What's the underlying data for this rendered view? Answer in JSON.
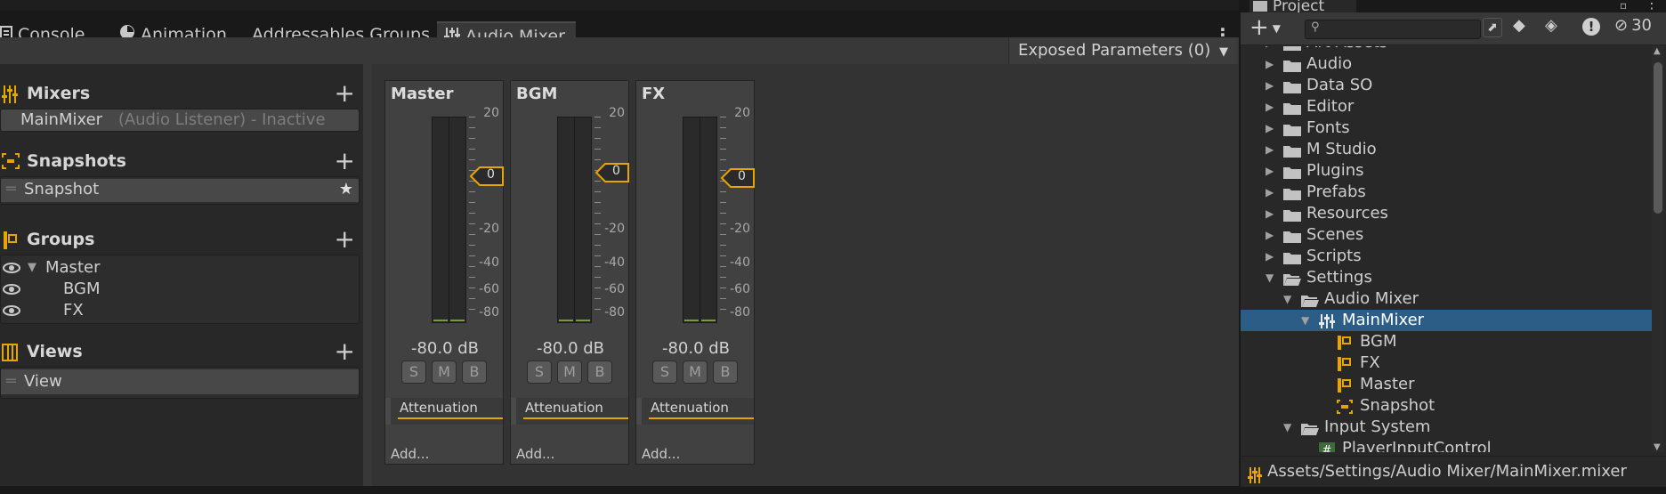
{
  "tabs": [
    {
      "label": "Console",
      "icon": "console-icon"
    },
    {
      "label": "Animation",
      "icon": "animation-icon"
    },
    {
      "label": "Addressables Groups",
      "icon": ""
    },
    {
      "label": "Audio Mixer",
      "icon": "audio-mixer-icon"
    }
  ],
  "toolbar": {
    "exposed_params": "Exposed Parameters (0)"
  },
  "sidebar": {
    "mixers": {
      "title": "Mixers",
      "item_name": "MainMixer",
      "item_suffix": "(Audio Listener) - Inactive"
    },
    "snapshots": {
      "title": "Snapshots",
      "item": "Snapshot"
    },
    "groups": {
      "title": "Groups",
      "items": [
        "Master",
        "BGM",
        "FX"
      ]
    },
    "views": {
      "title": "Views",
      "item": "View"
    }
  },
  "strips": [
    {
      "name": "Master",
      "db": "-80.0 dB",
      "fader_value": "0",
      "effect": "Attenuation",
      "add": "Add..."
    },
    {
      "name": "BGM",
      "db": "-80.0 dB",
      "fader_value": "0",
      "effect": "Attenuation",
      "add": "Add..."
    },
    {
      "name": "FX",
      "db": "-80.0 dB",
      "fader_value": "0",
      "effect": "Attenuation",
      "add": "Add..."
    }
  ],
  "scale_labels": [
    "20",
    "0",
    "-20",
    "-40",
    "-60",
    "-80"
  ],
  "buttons": {
    "solo": "S",
    "mute": "M",
    "bypass": "B"
  },
  "project": {
    "tab": "Project",
    "hidden_count": "30",
    "tree": [
      "Art Assets",
      "Audio",
      "Data SO",
      "Editor",
      "Fonts",
      "M Studio",
      "Plugins",
      "Prefabs",
      "Resources",
      "Scenes",
      "Scripts",
      "Settings",
      "Audio Mixer",
      "MainMixer",
      "BGM",
      "FX",
      "Master",
      "Snapshot",
      "Input System",
      "PlayerInputControl"
    ],
    "footer_path": "Assets/Settings/Audio Mixer/MainMixer.mixer"
  },
  "colors": {
    "accent": "#e8a500",
    "selection": "#2c5d87",
    "meter_level": "#7a9a3a"
  }
}
